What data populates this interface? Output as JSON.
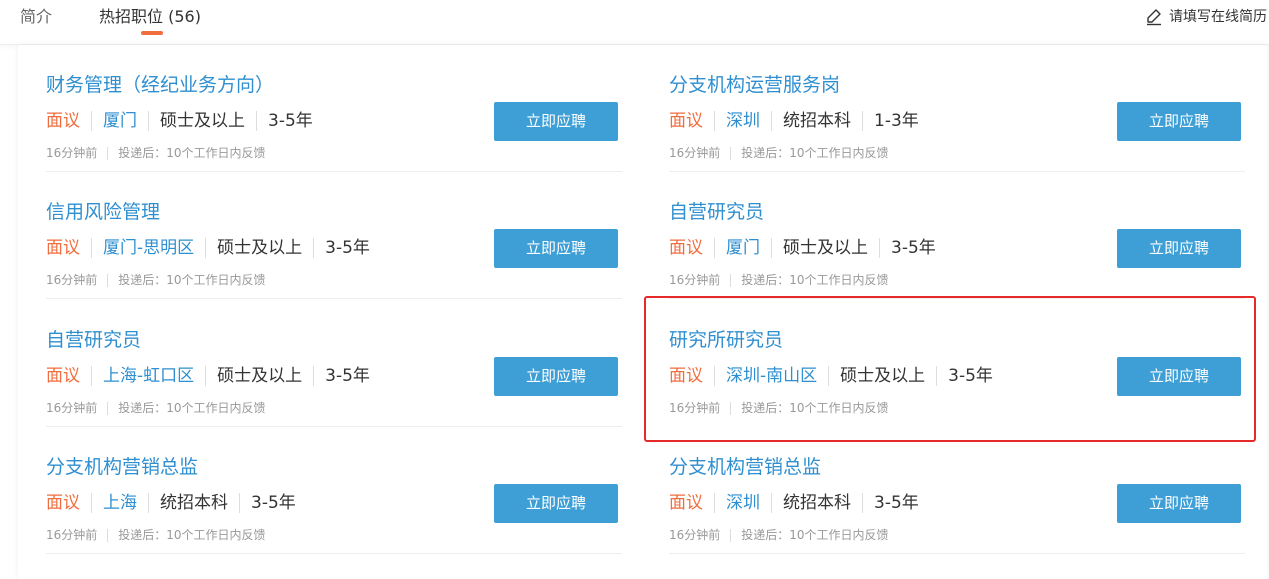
{
  "header": {
    "tabs": [
      {
        "label": "简介"
      },
      {
        "label": "热招职位 (56)"
      }
    ],
    "fill_resume_label": "请填写在线简历"
  },
  "common": {
    "apply_label": "立即应聘"
  },
  "jobs": [
    {
      "title": "财务管理（经纪业务方向）",
      "salary": "面议",
      "city": "厦门",
      "degree": "硕士及以上",
      "experience": "3-5年",
      "posted": "16分钟前",
      "feedback": "投递后：10个工作日内反馈"
    },
    {
      "title": "分支机构运营服务岗",
      "salary": "面议",
      "city": "深圳",
      "degree": "统招本科",
      "experience": "1-3年",
      "posted": "16分钟前",
      "feedback": "投递后：10个工作日内反馈"
    },
    {
      "title": "信用风险管理",
      "salary": "面议",
      "city": "厦门-思明区",
      "degree": "硕士及以上",
      "experience": "3-5年",
      "posted": "16分钟前",
      "feedback": "投递后：10个工作日内反馈"
    },
    {
      "title": "自营研究员",
      "salary": "面议",
      "city": "厦门",
      "degree": "硕士及以上",
      "experience": "3-5年",
      "posted": "16分钟前",
      "feedback": "投递后：10个工作日内反馈"
    },
    {
      "title": "自营研究员",
      "salary": "面议",
      "city": "上海-虹口区",
      "degree": "硕士及以上",
      "experience": "3-5年",
      "posted": "16分钟前",
      "feedback": "投递后：10个工作日内反馈"
    },
    {
      "title": "研究所研究员",
      "salary": "面议",
      "city": "深圳-南山区",
      "degree": "硕士及以上",
      "experience": "3-5年",
      "posted": "16分钟前",
      "feedback": "投递后：10个工作日内反馈"
    },
    {
      "title": "分支机构营销总监",
      "salary": "面议",
      "city": "上海",
      "degree": "统招本科",
      "experience": "3-5年",
      "posted": "16分钟前",
      "feedback": "投递后：10个工作日内反馈"
    },
    {
      "title": "分支机构营销总监",
      "salary": "面议",
      "city": "深圳",
      "degree": "统招本科",
      "experience": "3-5年",
      "posted": "16分钟前",
      "feedback": "投递后：10个工作日内反馈"
    }
  ],
  "colors": {
    "accent_blue": "#2f8fd0",
    "button_blue": "#3d9fd6",
    "salary_orange": "#f26d3d",
    "highlight_red": "#e52a2a"
  }
}
